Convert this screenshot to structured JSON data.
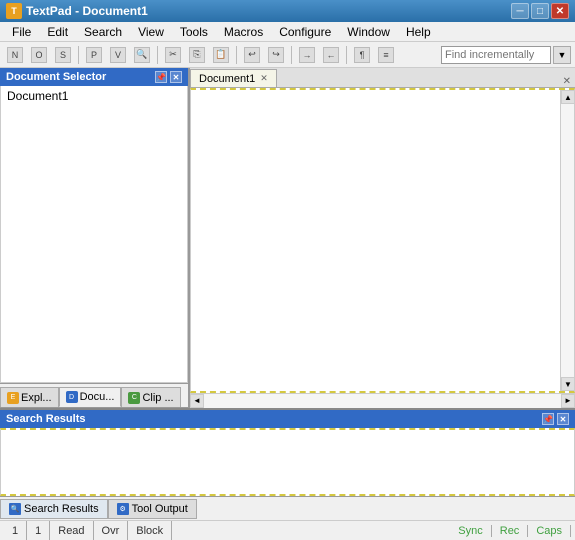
{
  "titleBar": {
    "title": "TextPad - Document1",
    "minBtn": "─",
    "maxBtn": "□",
    "closeBtn": "✕"
  },
  "menuBar": {
    "items": [
      "File",
      "Edit",
      "Search",
      "View",
      "Tools",
      "Macros",
      "Configure",
      "Window",
      "Help"
    ]
  },
  "toolbar": {
    "findPlaceholder": "Find incrementally"
  },
  "leftPanel": {
    "title": "Document Selector",
    "pinBtn": "📌",
    "closeBtn": "✕",
    "documents": [
      "Document1"
    ],
    "tabs": [
      {
        "label": "Expl...",
        "icon": "E"
      },
      {
        "label": "Docu...",
        "icon": "D"
      },
      {
        "label": "Clip ...",
        "icon": "C"
      }
    ]
  },
  "editorPanel": {
    "tabs": [
      {
        "label": "Document1",
        "close": "✕"
      }
    ],
    "closeBtn": "✕"
  },
  "searchPanel": {
    "title": "Search Results",
    "pinBtn": "📌",
    "closeBtn": "✕"
  },
  "bottomTabs": [
    {
      "label": "Search Results",
      "active": true
    },
    {
      "label": "Tool Output"
    }
  ],
  "statusBar": {
    "col": "1",
    "line": "1",
    "mode": "Read",
    "ovr": "Ovr",
    "block": "Block",
    "sync": "Sync",
    "rec": "Rec",
    "caps": "Caps"
  }
}
